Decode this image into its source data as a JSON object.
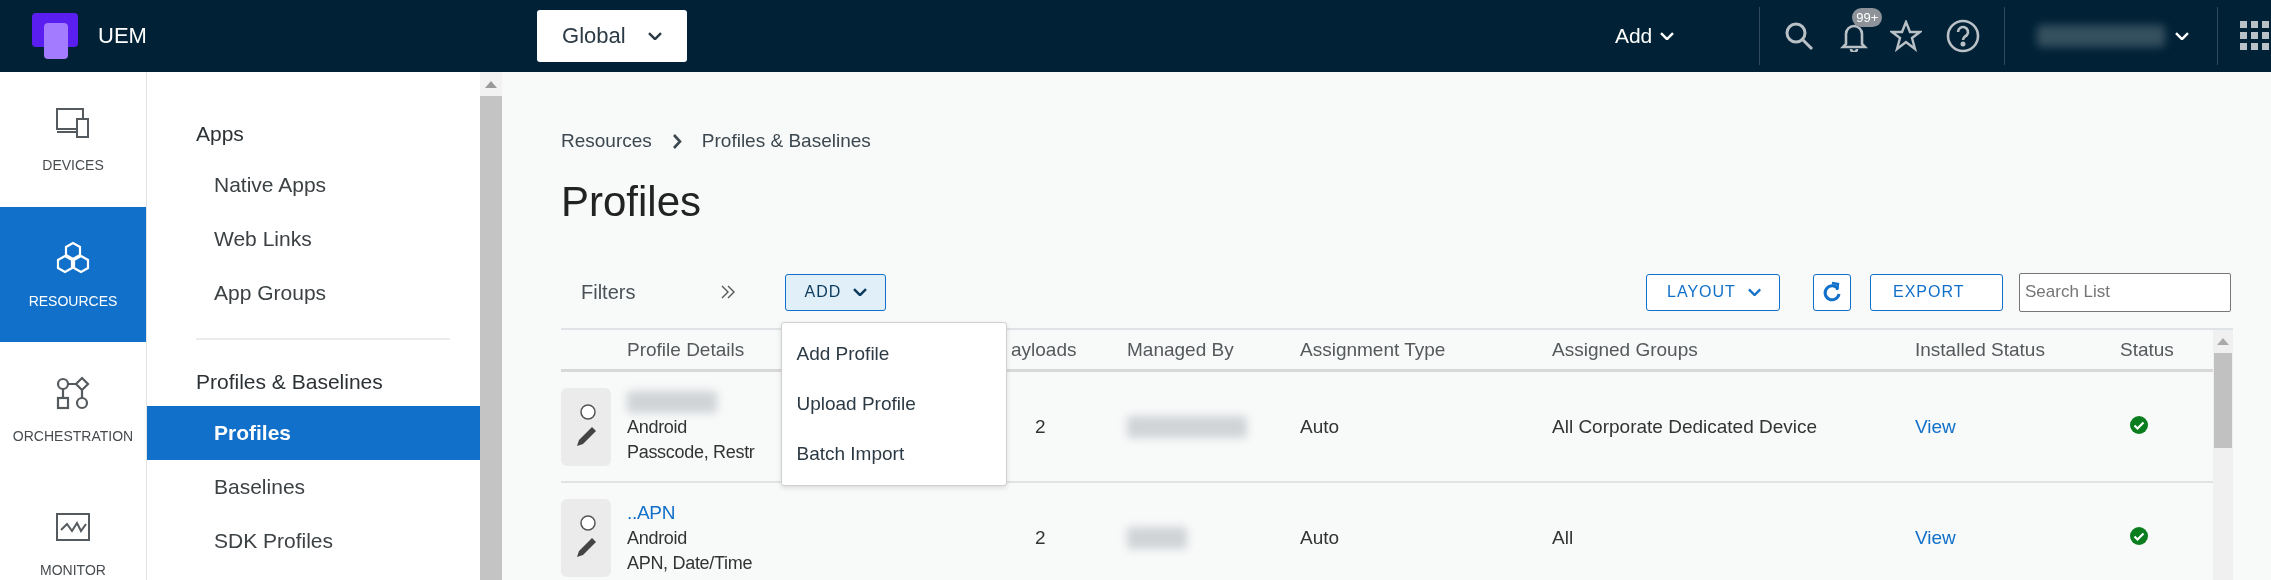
{
  "header": {
    "product": "UEM",
    "scope": "Global",
    "add_menu": "Add",
    "notification_count": "99+"
  },
  "rail": [
    {
      "label": "DEVICES",
      "selected": false
    },
    {
      "label": "RESOURCES",
      "selected": true
    },
    {
      "label": "ORCHESTRATION",
      "selected": false
    },
    {
      "label": "MONITOR",
      "selected": false
    }
  ],
  "sidebar": {
    "groups": [
      {
        "title": "Apps",
        "items": [
          {
            "label": "Native Apps",
            "selected": false
          },
          {
            "label": "Web Links",
            "selected": false
          },
          {
            "label": "App Groups",
            "selected": false
          }
        ]
      },
      {
        "title": "Profiles & Baselines",
        "items": [
          {
            "label": "Profiles",
            "selected": true
          },
          {
            "label": "Baselines",
            "selected": false
          },
          {
            "label": "SDK Profiles",
            "selected": false
          }
        ]
      }
    ]
  },
  "breadcrumb": [
    "Resources",
    "Profiles & Baselines"
  ],
  "title": "Profiles",
  "toolbar": {
    "filters": "Filters",
    "add": "ADD",
    "layout": "LAYOUT",
    "export": "EXPORT",
    "search_placeholder": "Search List"
  },
  "add_dropdown": {
    "open": true,
    "items": [
      "Add Profile",
      "Upload Profile",
      "Batch Import"
    ]
  },
  "table": {
    "columns": [
      "Profile Details",
      "ayloads",
      "Managed By",
      "Assignment Type",
      "Assigned Groups",
      "Installed Status",
      "Status"
    ],
    "rows": [
      {
        "platform": "Android",
        "payload_types": "Passcode, Restr",
        "payloads": "2",
        "assignment_type": "Auto",
        "assigned_groups": "All Corporate Dedicated Device",
        "installed_status": "View",
        "status_ok": true
      },
      {
        "name": "..APN",
        "platform": "Android",
        "payload_types": "APN, Date/Time",
        "payloads": "2",
        "assignment_type": "Auto",
        "assigned_groups": "All",
        "installed_status": "View",
        "status_ok": true
      }
    ]
  }
}
